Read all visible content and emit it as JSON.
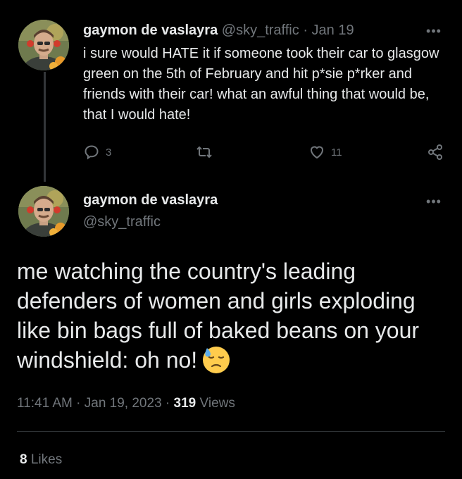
{
  "reply_tweet": {
    "author_name": "gaymon de vaslayra",
    "author_handle": "@sky_traffic",
    "separator": "·",
    "date": "Jan 19",
    "text": "i sure would HATE it if someone took their car to glasgow green on the 5th of February and hit p*sie p*rker and friends with their car! what an awful thing that would be, that I would hate!",
    "reply_count": "3",
    "like_count": "11",
    "icons": [
      "reply-icon",
      "retweet-icon",
      "like-icon",
      "share-icon",
      "more-icon"
    ]
  },
  "main_tweet": {
    "author_name": "gaymon de vaslayra",
    "author_handle": "@sky_traffic",
    "text": "me watching the country's leading defenders of women and girls exploding like bin bags full of baked beans on your windshield: oh no!",
    "emoji": "downcast-face-with-sweat-emoji",
    "time": "11:41 AM",
    "separator": "·",
    "date": "Jan 19, 2023",
    "views_count": "319",
    "views_label": "Views",
    "likes_count": "8",
    "likes_label": "Likes"
  },
  "colors": {
    "background": "#000000",
    "primary_text": "#e7e9ea",
    "secondary_text": "#71767b",
    "divider": "#2f3336"
  }
}
